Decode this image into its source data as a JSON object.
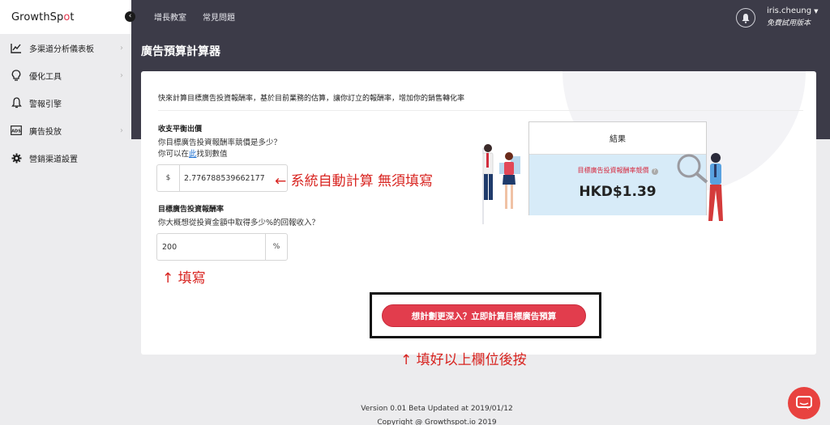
{
  "app": {
    "logo_prefix": "GrowthSp",
    "logo_dot": "o",
    "logo_suffix": "t"
  },
  "sidebar": {
    "items": [
      {
        "label": "多渠道分析儀表板",
        "icon": "chart-line-icon"
      },
      {
        "label": "優化工具",
        "icon": "lightbulb-icon"
      },
      {
        "label": "警報引擎",
        "icon": "bell-icon"
      },
      {
        "label": "廣告投放",
        "icon": "ads-icon"
      },
      {
        "label": "營銷渠道設置",
        "icon": "gear-icon"
      }
    ]
  },
  "topbar": {
    "nav": [
      "增長教室",
      "常見問題"
    ],
    "username": "iris.cheung",
    "plan": "免費試用版本"
  },
  "page": {
    "title": "廣告預算計算器"
  },
  "calculator": {
    "intro": "快來計算目標廣告投資報酬率，基於目前業務的估算，讓你訂立的報酬率，增加你的銷售轉化率",
    "breakeven": {
      "title": "收支平衡出價",
      "question": "你目標廣告投資報酬率競價是多少？",
      "hint_prefix": "你可以在",
      "hint_link": "此",
      "hint_suffix": "找到數值",
      "currency": "$",
      "value": "2.776788539662177"
    },
    "target_roas": {
      "title": "目標廣告投資報酬率",
      "question": "你大概想從投資金額中取得多少%的回報收入？",
      "value": "200",
      "unit": "%"
    },
    "result": {
      "header": "結果",
      "label": "目標廣告投資報酬率競價",
      "value": "HKD$1.39"
    },
    "cta_label": "想計劃更深入？立即計算目標廣告預算"
  },
  "annotations": {
    "auto": "← 系統自動計算 無須填寫",
    "fill": "↑ 填寫",
    "press": "↑ 填好以上欄位後按"
  },
  "footer": {
    "version": "Version 0.01 Beta Updated at 2019/01/12",
    "copyright": "Copyright @ Growthspot.io 2019"
  },
  "colors": {
    "accent": "#e23d4d",
    "topbar": "#3c3b48",
    "result_bg": "#d7ebf8",
    "annotation": "#d8231f"
  }
}
